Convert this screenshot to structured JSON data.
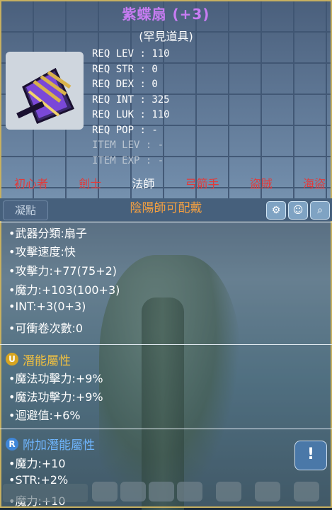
{
  "item": {
    "name": "紫蝶扇 (+3)",
    "rarity": "(罕見道具)"
  },
  "requirements": [
    {
      "label": "REQ LEV",
      "value": "110"
    },
    {
      "label": "REQ STR",
      "value": "0"
    },
    {
      "label": "REQ DEX",
      "value": "0"
    },
    {
      "label": "REQ INT",
      "value": "325"
    },
    {
      "label": "REQ LUK",
      "value": "110"
    },
    {
      "label": "REQ POP",
      "value": "-"
    },
    {
      "label": "ITEM LEV",
      "value": "-"
    },
    {
      "label": "ITEM EXP",
      "value": "-"
    }
  ],
  "classes": [
    "初心者",
    "劍士",
    "法師",
    "弓箭手",
    "盜賊",
    "海盜"
  ],
  "active_class": "法師",
  "toolbar": {
    "left_button": "凝點",
    "job": "陰陽師可配戴",
    "icons": [
      "gear-icon",
      "face-icon",
      "search-icon"
    ]
  },
  "stats": [
    "•武器分類:扇子",
    "•攻擊速度:快",
    "•攻擊力:+77(75+2)",
    "•魔力:+103(100+3)",
    "•INT:+3(0+3)",
    "•可衝卷次數:0"
  ],
  "potential": {
    "badge": "U",
    "title": "潛能屬性",
    "lines": [
      "•魔法功擊力:+9%",
      "•魔法功擊力:+9%",
      "•迴避值:+6%"
    ]
  },
  "additional": {
    "badge": "R",
    "title": "附加潛能屬性",
    "lines": [
      "•魔力:+10",
      "•STR:+2%",
      "•魔力:+10"
    ]
  },
  "colors": {
    "title": "#c77cf2",
    "class_off": "#e23a3a",
    "job": "#f5a040",
    "potential_title": "#f0c040",
    "additional_title": "#6fb6ff",
    "border": "#c7b060"
  }
}
